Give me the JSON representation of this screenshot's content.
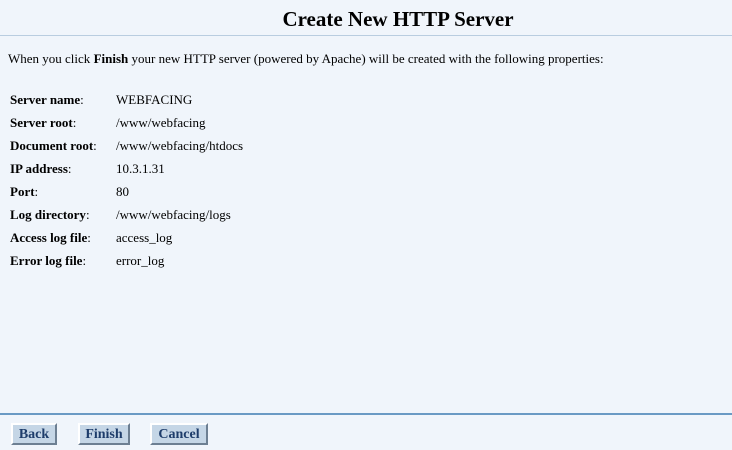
{
  "header": {
    "title": "Create New HTTP Server"
  },
  "intro": {
    "before": "When you click ",
    "bold": "Finish",
    "after": " your new HTTP server (powered by Apache) will be created with the following properties:"
  },
  "properties": [
    {
      "label": "Server name",
      "value": "WEBFACING"
    },
    {
      "label": "Server root",
      "value": "/www/webfacing"
    },
    {
      "label": "Document root",
      "value": "/www/webfacing/htdocs"
    },
    {
      "label": "IP address",
      "value": "10.3.1.31"
    },
    {
      "label": "Port",
      "value": "80"
    },
    {
      "label": "Log directory",
      "value": "/www/webfacing/logs"
    },
    {
      "label": "Access log file",
      "value": "access_log"
    },
    {
      "label": "Error log file",
      "value": "error_log"
    }
  ],
  "footer": {
    "back_label": "Back",
    "finish_label": "Finish",
    "cancel_label": "Cancel"
  }
}
